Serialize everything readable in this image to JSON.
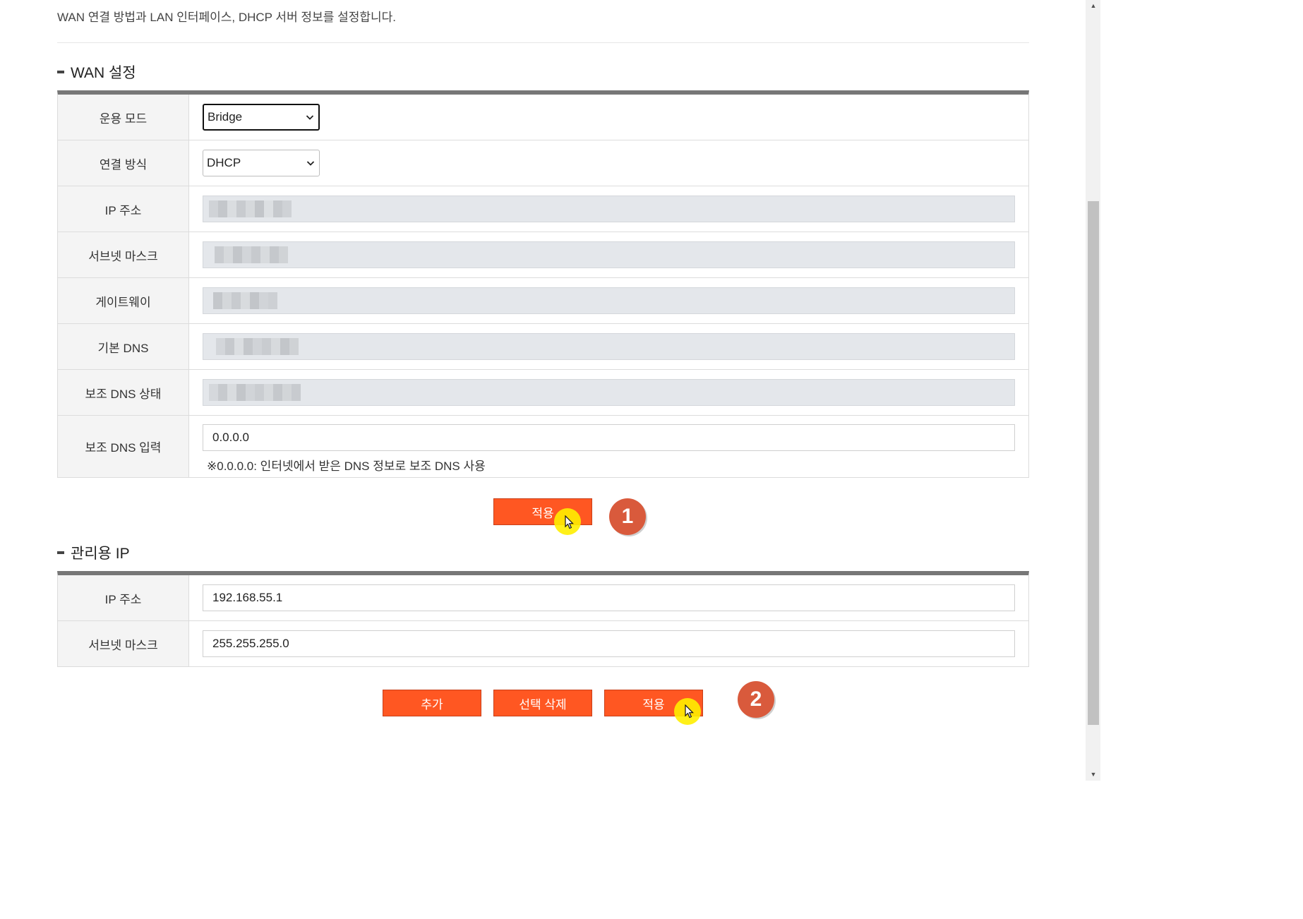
{
  "description": "WAN 연결 방법과 LAN 인터페이스, DHCP 서버 정보를 설정합니다.",
  "wan_section": {
    "title": "WAN 설정",
    "rows": {
      "operation_mode": {
        "label": "운용 모드",
        "value": "Bridge"
      },
      "connection_type": {
        "label": "연결 방식",
        "value": "DHCP"
      },
      "ip_address": {
        "label": "IP 주소"
      },
      "subnet_mask": {
        "label": "서브넷 마스크"
      },
      "gateway": {
        "label": "게이트웨이"
      },
      "primary_dns": {
        "label": "기본 DNS"
      },
      "secondary_dns_status": {
        "label": "보조 DNS 상태"
      },
      "secondary_dns_input": {
        "label": "보조 DNS 입력",
        "value": "0.0.0.0",
        "hint": "※0.0.0.0: 인터넷에서 받은 DNS 정보로 보조 DNS 사용"
      }
    },
    "apply_label": "적용",
    "step_badge": "1"
  },
  "mgmt_section": {
    "title": "관리용 IP",
    "rows": {
      "ip_address": {
        "label": "IP 주소",
        "value": "192.168.55.1"
      },
      "subnet_mask": {
        "label": "서브넷 마스크",
        "value": "255.255.255.0"
      }
    },
    "add_label": "추가",
    "delete_selected_label": "선택 삭제",
    "apply_label": "적용",
    "step_badge": "2"
  },
  "colors": {
    "button": "#ff5722",
    "step_badge": "#d95a3c",
    "cursor_highlight": "#ffee00",
    "table_top_border": "#777777"
  }
}
